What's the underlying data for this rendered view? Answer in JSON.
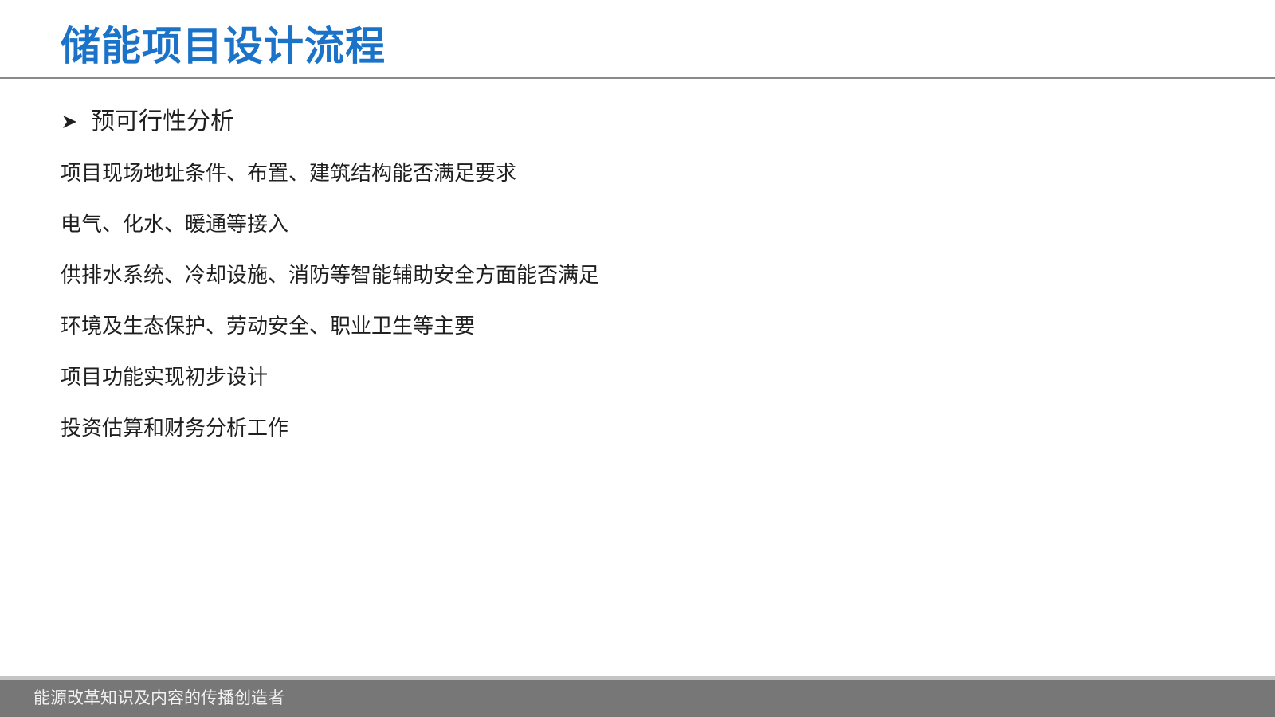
{
  "slide": {
    "title": "储能项目设计流程",
    "section": {
      "bullet_icon": "arrowhead-bullet-icon",
      "heading": "预可行性分析"
    },
    "items": [
      "项目现场地址条件、布置、建筑结构能否满足要求",
      "电气、化水、暖通等接入",
      "供排水系统、冷却设施、消防等智能辅助安全方面能否满足",
      "环境及生态保护、劳动安全、职业卫生等主要",
      "项目功能实现初步设计",
      "投资估算和财务分析工作"
    ],
    "footer_text": "能源改革知识及内容的传播创造者"
  },
  "colors": {
    "title": "#1a73c9",
    "text": "#1f1f1f",
    "footer_bg": "#777777",
    "footer_band": "#c4c4c4",
    "rule": "#8a8a8a"
  }
}
